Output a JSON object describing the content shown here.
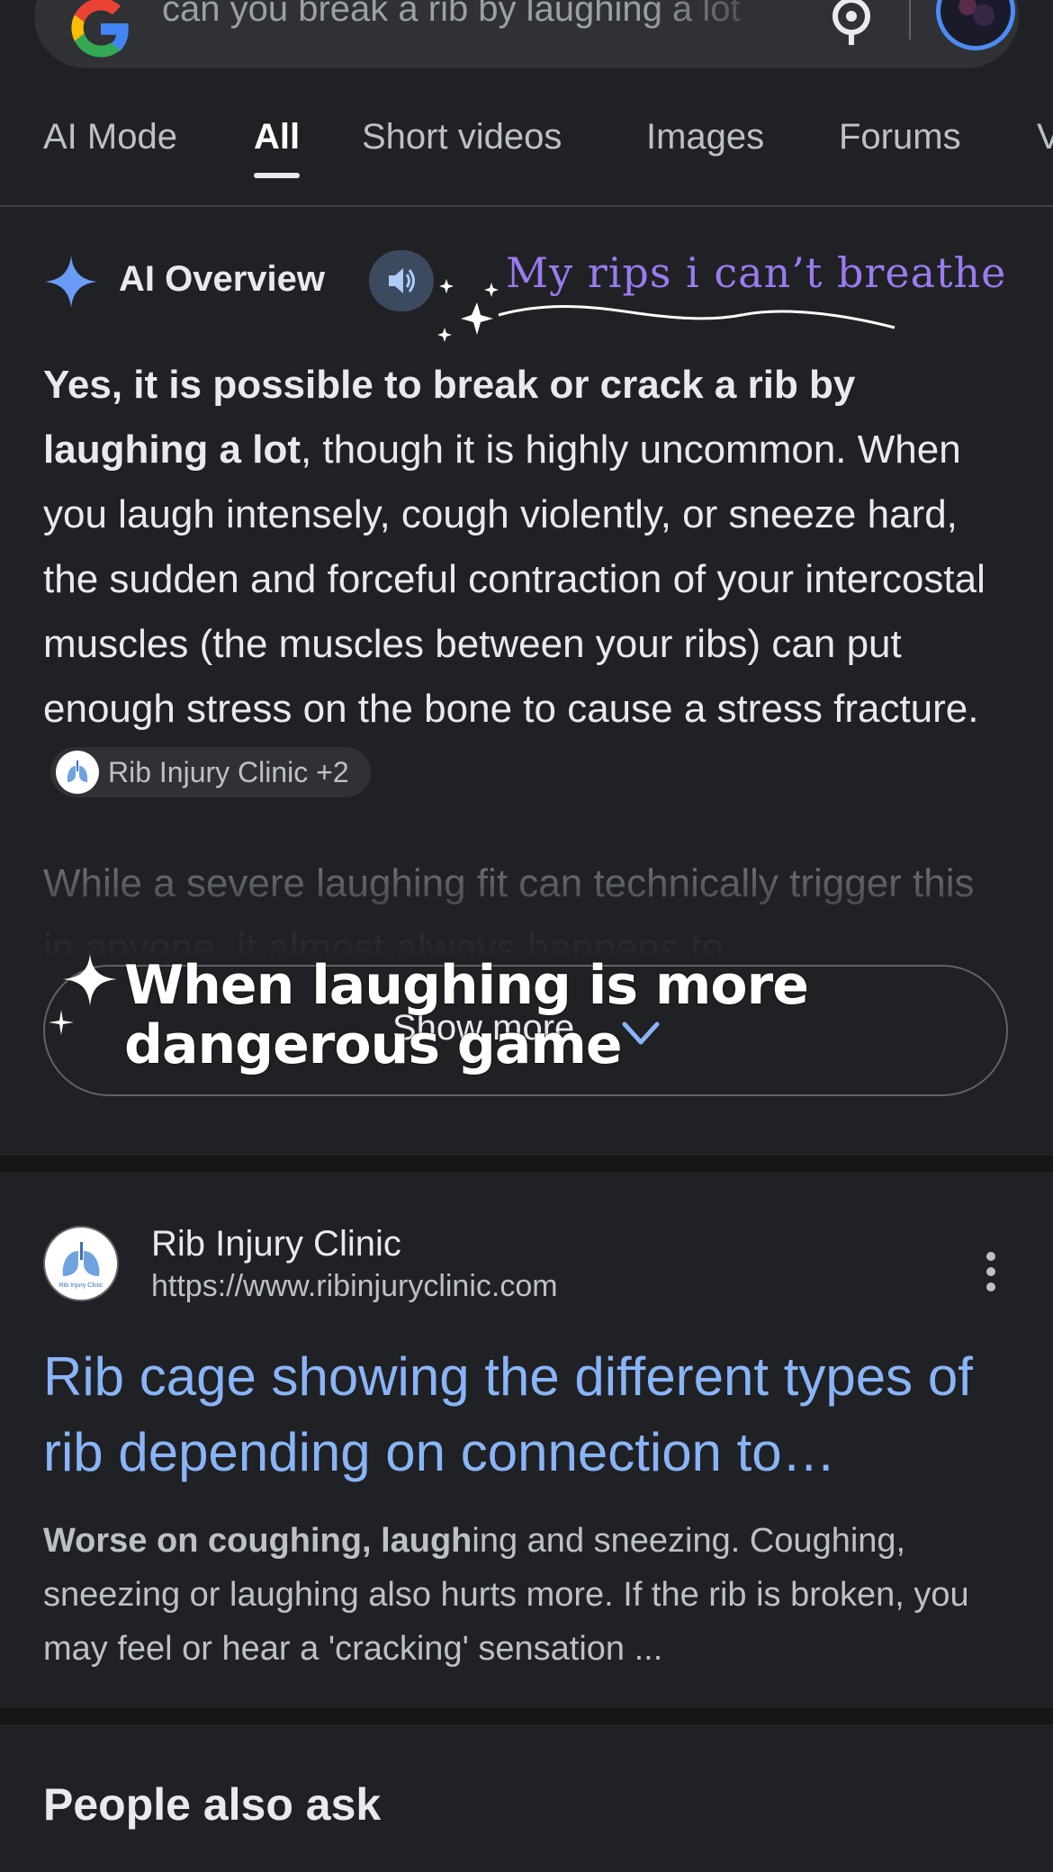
{
  "search": {
    "query": "can you break a rib by laughing a lot"
  },
  "tabs": [
    {
      "label": "AI Mode"
    },
    {
      "label": "All"
    },
    {
      "label": "Short videos"
    },
    {
      "label": "Images"
    },
    {
      "label": "Forums"
    },
    {
      "label": "V"
    }
  ],
  "ai_overview": {
    "title": "AI Overview",
    "bold_intro": "Yes, it is possible to break or crack a rib by laughing a lot",
    "body": ", though it is highly uncommon. When you laugh intensely, cough violently, or sneeze hard, the sudden and forceful contraction of your intercostal muscles (the muscles between your ribs) can put enough stress on the bone to cause a stress fracture.",
    "source_chip": "Rib Injury Clinic +2",
    "faded_text": "While a severe laughing fit can technically trigger this in anyone, it almost always happens to",
    "show_more": "Show more"
  },
  "overlay": {
    "handwritten_caption": "My rips i can’t breathe",
    "sticker_line1": "When laughing is more",
    "sticker_line2": "dangerous game"
  },
  "result": {
    "site_name": "Rib Injury Clinic",
    "site_url": "https://www.ribinjuryclinic.com",
    "logo_text": "Rib Injury Clinic",
    "title": "Rib cage showing the different types of rib depending on connection to…",
    "snippet_bold": "Worse on coughing, laugh",
    "snippet_rest": "ing and sneezing. Coughing, sneezing or laughing also hurts more. If the rib is broken, you may feel or hear a 'cracking' sensation ..."
  },
  "people_also_ask": {
    "heading": "People also ask"
  },
  "colors": {
    "background": "#202124",
    "link": "#8ab4f8",
    "accent_purple": "#9a7bf0",
    "avatar_ring": "#4d8bf5"
  },
  "icons": [
    "google-logo-icon",
    "lens-icon",
    "ai-sparkle-icon",
    "speaker-icon",
    "chevron-down-icon",
    "more-vert-icon",
    "lungs-icon"
  ]
}
